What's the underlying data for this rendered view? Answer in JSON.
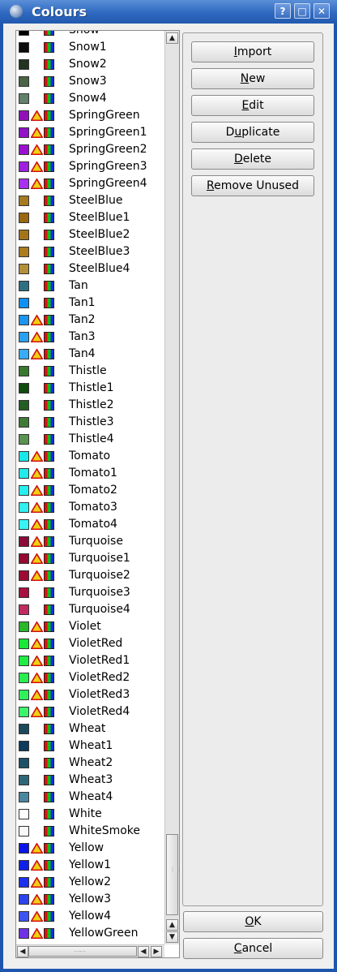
{
  "window": {
    "title": "Colours",
    "help_label": "?",
    "maximize_label": "□",
    "close_label": "✕"
  },
  "buttons": {
    "import": {
      "pre": "",
      "key": "I",
      "post": "mport"
    },
    "new": {
      "pre": "",
      "key": "N",
      "post": "ew"
    },
    "edit": {
      "pre": "",
      "key": "E",
      "post": "dit"
    },
    "duplicate": {
      "pre": "D",
      "key": "u",
      "post": "plicate"
    },
    "delete": {
      "pre": "",
      "key": "D",
      "post": "elete"
    },
    "remove_unused": {
      "pre": "",
      "key": "R",
      "post": "emove Unused"
    },
    "ok": {
      "pre": "",
      "key": "O",
      "post": "K"
    },
    "cancel": {
      "pre": "",
      "key": "C",
      "post": "ancel"
    }
  },
  "colors": [
    {
      "name": "Snow",
      "swatch": "#000000",
      "warn": false
    },
    {
      "name": "Snow1",
      "swatch": "#0a0d0a",
      "warn": false
    },
    {
      "name": "Snow2",
      "swatch": "#223322",
      "warn": false
    },
    {
      "name": "Snow3",
      "swatch": "#4a6445",
      "warn": false
    },
    {
      "name": "Snow4",
      "swatch": "#62806a",
      "warn": false
    },
    {
      "name": "SpringGreen",
      "swatch": "#9010b8",
      "warn": true
    },
    {
      "name": "SpringGreen1",
      "swatch": "#9210c8",
      "warn": true
    },
    {
      "name": "SpringGreen2",
      "swatch": "#9a10d0",
      "warn": true
    },
    {
      "name": "SpringGreen3",
      "swatch": "#a020e0",
      "warn": true
    },
    {
      "name": "SpringGreen4",
      "swatch": "#a830f0",
      "warn": true
    },
    {
      "name": "SteelBlue",
      "swatch": "#a57a20",
      "warn": false
    },
    {
      "name": "SteelBlue1",
      "swatch": "#9a6810",
      "warn": false
    },
    {
      "name": "SteelBlue2",
      "swatch": "#a4741a",
      "warn": false
    },
    {
      "name": "SteelBlue3",
      "swatch": "#ab7c20",
      "warn": false
    },
    {
      "name": "SteelBlue4",
      "swatch": "#b4903a",
      "warn": false
    },
    {
      "name": "Tan",
      "swatch": "#2d7082",
      "warn": false
    },
    {
      "name": "Tan1",
      "swatch": "#1090f0",
      "warn": false
    },
    {
      "name": "Tan2",
      "swatch": "#1c94f0",
      "warn": true
    },
    {
      "name": "Tan3",
      "swatch": "#2aa0f2",
      "warn": true
    },
    {
      "name": "Tan4",
      "swatch": "#38acf6",
      "warn": true
    },
    {
      "name": "Thistle",
      "swatch": "#3a7830",
      "warn": false
    },
    {
      "name": "Thistle1",
      "swatch": "#104c10",
      "warn": false
    },
    {
      "name": "Thistle2",
      "swatch": "#245e24",
      "warn": false
    },
    {
      "name": "Thistle3",
      "swatch": "#3f7a36",
      "warn": false
    },
    {
      "name": "Thistle4",
      "swatch": "#5a9450",
      "warn": false
    },
    {
      "name": "Tomato",
      "swatch": "#18e8e8",
      "warn": true
    },
    {
      "name": "Tomato1",
      "swatch": "#20eaea",
      "warn": true
    },
    {
      "name": "Tomato2",
      "swatch": "#28eeee",
      "warn": true
    },
    {
      "name": "Tomato3",
      "swatch": "#30f0f0",
      "warn": true
    },
    {
      "name": "Tomato4",
      "swatch": "#38f4f4",
      "warn": true
    },
    {
      "name": "Turquoise",
      "swatch": "#8a0a3a",
      "warn": true
    },
    {
      "name": "Turquoise1",
      "swatch": "#940a30",
      "warn": true
    },
    {
      "name": "Turquoise2",
      "swatch": "#9c0c34",
      "warn": true
    },
    {
      "name": "Turquoise3",
      "swatch": "#a81040",
      "warn": false
    },
    {
      "name": "Turquoise4",
      "swatch": "#c02c60",
      "warn": false
    },
    {
      "name": "Violet",
      "swatch": "#2ab82a",
      "warn": true
    },
    {
      "name": "VioletRed",
      "swatch": "#18e838",
      "warn": true
    },
    {
      "name": "VioletRed1",
      "swatch": "#20ec44",
      "warn": true
    },
    {
      "name": "VioletRed2",
      "swatch": "#28ee50",
      "warn": true
    },
    {
      "name": "VioletRed3",
      "swatch": "#30f05c",
      "warn": true
    },
    {
      "name": "VioletRed4",
      "swatch": "#3cf46c",
      "warn": true
    },
    {
      "name": "Wheat",
      "swatch": "#1c4a5a",
      "warn": false
    },
    {
      "name": "Wheat1",
      "swatch": "#0e3a5c",
      "warn": false
    },
    {
      "name": "Wheat2",
      "swatch": "#1e5266",
      "warn": false
    },
    {
      "name": "Wheat3",
      "swatch": "#2e6878",
      "warn": false
    },
    {
      "name": "Wheat4",
      "swatch": "#4a86a0",
      "warn": false
    },
    {
      "name": "White",
      "swatch": "#ffffff",
      "warn": false
    },
    {
      "name": "WhiteSmoke",
      "swatch": "#f8f8f8",
      "warn": false
    },
    {
      "name": "Yellow",
      "swatch": "#0a14e8",
      "warn": true
    },
    {
      "name": "Yellow1",
      "swatch": "#1020ea",
      "warn": true
    },
    {
      "name": "Yellow2",
      "swatch": "#1c30ee",
      "warn": true
    },
    {
      "name": "Yellow3",
      "swatch": "#2e44f0",
      "warn": true
    },
    {
      "name": "Yellow4",
      "swatch": "#3c54f2",
      "warn": true
    },
    {
      "name": "YellowGreen",
      "swatch": "#7030e8",
      "warn": true
    }
  ]
}
